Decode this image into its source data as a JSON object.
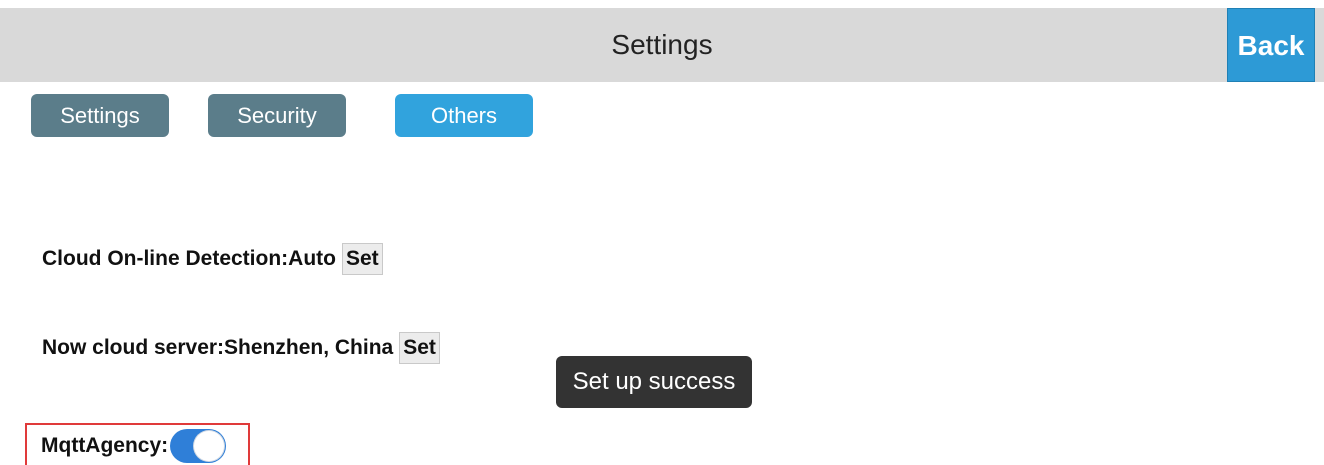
{
  "header": {
    "title": "Settings",
    "back_label": "Back"
  },
  "tabs": [
    {
      "label": "Settings",
      "active": false
    },
    {
      "label": "Security",
      "active": false
    },
    {
      "label": "Others",
      "active": true
    }
  ],
  "cloud_detection": {
    "label": "Cloud On-line Detection:Auto",
    "set_label": "Set"
  },
  "cloud_server": {
    "label": "Now cloud server:Shenzhen, China",
    "set_label": "Set"
  },
  "toast": {
    "message": "Set up success"
  },
  "mqtt_agency": {
    "label": "MqttAgency:",
    "enabled": true
  },
  "colors": {
    "header_bg": "#d9d9d9",
    "back_button": "#2d9ad6",
    "tab_inactive": "#5b7d8a",
    "tab_active": "#31a3dd",
    "toggle_on": "#2f7fd8",
    "highlight_box": "#e03a3a"
  }
}
